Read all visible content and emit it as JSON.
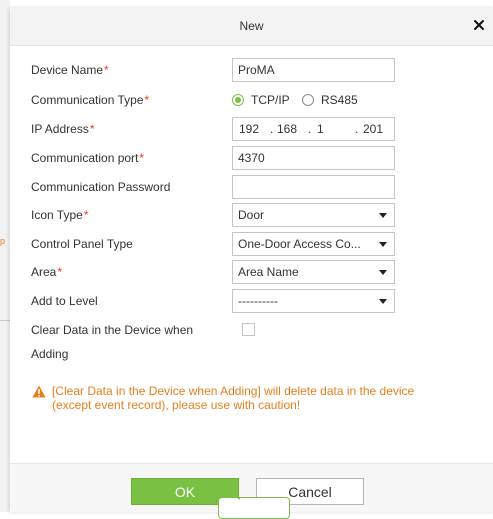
{
  "dialog": {
    "title": "New",
    "close_glyph": "×"
  },
  "form": {
    "device_name": {
      "label": "Device Name",
      "required": "*",
      "value": "ProMA"
    },
    "communication_type": {
      "label": "Communication Type",
      "required": "*",
      "options": [
        {
          "label": "TCP/IP",
          "selected": true
        },
        {
          "label": "RS485",
          "selected": false
        }
      ]
    },
    "ip_address": {
      "label": "IP Address",
      "required": "*",
      "octets": [
        "192",
        "168",
        "1",
        "201"
      ],
      "dot": "."
    },
    "communication_port": {
      "label": "Communication port",
      "required": "*",
      "value": "4370"
    },
    "communication_password": {
      "label": "Communication Password",
      "value": ""
    },
    "icon_type": {
      "label": "Icon Type",
      "required": "*",
      "value": "Door"
    },
    "control_panel_type": {
      "label": "Control Panel Type",
      "value": "One-Door Access Co..."
    },
    "area": {
      "label": "Area",
      "required": "*",
      "value": "Area Name"
    },
    "add_to_level": {
      "label": "Add to Level",
      "value": "----------"
    },
    "clear_data": {
      "label_line1": "Clear Data in the Device when",
      "label_line2": "Adding",
      "checked": false
    }
  },
  "warning": {
    "text_line1": "[Clear Data in the Device when Adding] will delete data in the device",
    "text_line2": "(except event record), please use with caution!"
  },
  "buttons": {
    "ok": "OK",
    "cancel": "Cancel"
  },
  "background": {
    "snippet": "p"
  },
  "colors": {
    "accent_green": "#7ac143",
    "required_red": "#e83828",
    "warning_orange": "#e5801c"
  },
  "icons": {
    "close": "close-icon",
    "warning": "warning-icon",
    "caret": "chevron-down-icon"
  }
}
